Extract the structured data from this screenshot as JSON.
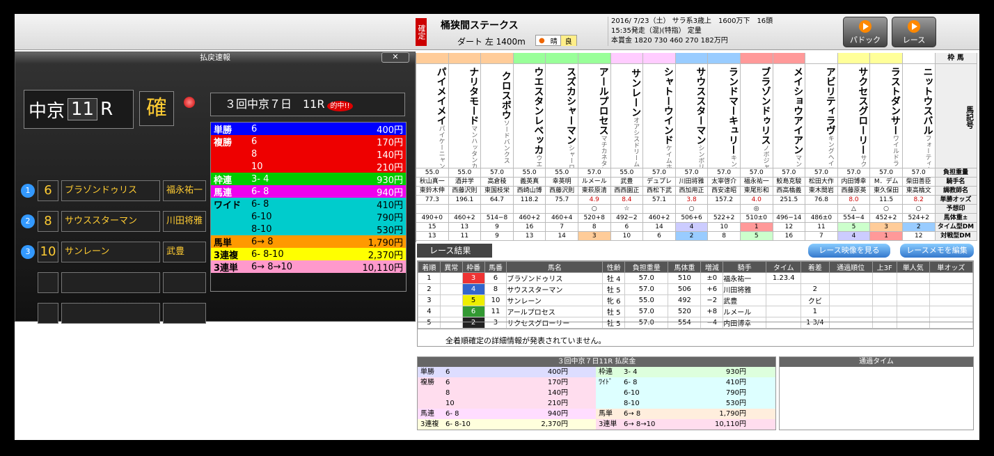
{
  "header": {
    "kakutei": "確定",
    "race_name": "桶狭間ステークス",
    "course": "ダート 左 1400m",
    "weather": "晴",
    "baba": "良",
    "info1": "2016/ 7/23（土） サラ系3歳上　1600万下　16頭",
    "info2": "15:35発走（混)(特指） 定量",
    "info3": "本賞金 1820 730 460 270 182万円",
    "btn_paddock": "パドック",
    "btn_race": "レース"
  },
  "panel": {
    "title": "払戻速報",
    "close": "✕",
    "place": "中京",
    "race_no": "11",
    "r": "R",
    "kaku": "確",
    "race_label": "３回中京７日　11R",
    "hit": "的中!!",
    "results": [
      {
        "pos": "1",
        "num": "6",
        "horse": "ブラゾンドゥリス",
        "jockey": "福永祐一"
      },
      {
        "pos": "2",
        "num": "8",
        "horse": "サウススターマン",
        "jockey": "川田将雅"
      },
      {
        "pos": "3",
        "num": "10",
        "horse": "サンレーン",
        "jockey": "武豊"
      }
    ],
    "pay": [
      {
        "type": "単勝",
        "combo": "6",
        "pay": "400円",
        "bg": "#00f"
      },
      {
        "type": "複勝",
        "combo": "6",
        "pay": "170円",
        "bg": "#e00"
      },
      {
        "type": "",
        "combo": "8",
        "pay": "140円",
        "bg": "#e00"
      },
      {
        "type": "",
        "combo": "10",
        "pay": "210円",
        "bg": "#e00"
      },
      {
        "type": "枠連",
        "combo": "3- 4",
        "pay": "930円",
        "bg": "#0c0"
      },
      {
        "type": "馬連",
        "combo": "6- 8",
        "pay": "940円",
        "bg": "#e0e"
      },
      {
        "type": "ワイド",
        "combo": "6- 8",
        "pay": "410円",
        "bg": "#0cc"
      },
      {
        "type": "",
        "combo": "6-10",
        "pay": "790円",
        "bg": "#0cc"
      },
      {
        "type": "",
        "combo": "8-10",
        "pay": "530円",
        "bg": "#0cc"
      },
      {
        "type": "馬単",
        "combo": "6→ 8",
        "pay": "1,790円",
        "bg": "#f90"
      },
      {
        "type": "3連複",
        "combo": "6- 8-10",
        "pay": "2,370円",
        "bg": "#ff0"
      },
      {
        "type": "3連単",
        "combo": "6→ 8→10",
        "pay": "10,110円",
        "bg": "#f9c"
      }
    ]
  },
  "entries": {
    "waku_row": [
      "16",
      "⑧",
      "15",
      "14",
      "⑦",
      "13",
      "12",
      "⑥",
      "11",
      "10",
      "⑤",
      "9",
      "8",
      "④",
      "7",
      "6",
      "③",
      "5",
      "4",
      "②",
      "3",
      "2",
      "①",
      "1"
    ],
    "horses": [
      {
        "n": "パイメイメイ",
        "w": "#fc9",
        "f": "パイケーニャン",
        "wt": "55.0",
        "j": "秋山真一",
        "t": "東鈴木伸",
        "o": "77.3",
        "m": "",
        "bw": "490+0",
        "t1": "15",
        "t2": "13"
      },
      {
        "n": "ナリタモード",
        "w": "#fc9",
        "f": "マンハッタンカフェ",
        "wt": "55.0",
        "j": "酒井学",
        "t": "西藤沢則",
        "o": "196.1",
        "m": "",
        "bw": "460+2",
        "t1": "13",
        "t2": "11"
      },
      {
        "n": "クロスボウ",
        "w": "#fc9",
        "f": "ソードバンクス",
        "wt": "57.0",
        "j": "高倉稜",
        "t": "東国枝栄",
        "o": "64.7",
        "m": "",
        "bw": "514−8",
        "t1": "9",
        "t2": "9"
      },
      {
        "n": "ウエスタンレベッカ",
        "w": "#9f9",
        "f": "ウエスタンアロー",
        "wt": "55.0",
        "j": "義英真",
        "t": "西崎山博",
        "o": "118.2",
        "m": "",
        "bw": "460+2",
        "t1": "16",
        "t2": "13"
      },
      {
        "n": "スズカシャーマン",
        "w": "#9f9",
        "f": "シャーロック",
        "wt": "55.0",
        "j": "幸英明",
        "t": "西藤沢則",
        "o": "75.7",
        "m": "",
        "bw": "460+4",
        "t1": "7",
        "t2": "14"
      },
      {
        "n": "アールプロセス",
        "w": "#9f9",
        "f": "マチカネタンホイザ",
        "wt": "57.0",
        "j": "ルメール",
        "t": "東萩原清",
        "o": "4.9",
        "m": "○",
        "bw": "520+8",
        "t1": "8",
        "t2": "3"
      },
      {
        "n": "サンレーン",
        "w": "#fcf",
        "f": "オアシスドリーム",
        "wt": "55.0",
        "j": "武豊",
        "t": "西西園正",
        "o": "8.4",
        "m": "☆",
        "bw": "492−2",
        "t1": "6",
        "t2": "10"
      },
      {
        "n": "シャトーウインド",
        "w": "#fcf",
        "f": "ケイムホーム",
        "wt": "57.0",
        "j": "デュプレ",
        "t": "西松下武",
        "o": "57.1",
        "m": "",
        "bw": "460+2",
        "t1": "14",
        "t2": "6"
      },
      {
        "n": "サウススターマン",
        "w": "#9cf",
        "f": "シンボリクリスエス",
        "wt": "57.0",
        "j": "川田将雅",
        "t": "西加用正",
        "o": "3.8",
        "m": "○",
        "bw": "506+6",
        "t1": "4",
        "t2": "2"
      },
      {
        "n": "ランドマーキュリー",
        "w": "#9cf",
        "f": "キングカメハメハ",
        "wt": "57.0",
        "j": "太宰啓介",
        "t": "西安達昭",
        "o": "157.2",
        "m": "",
        "bw": "522+2",
        "t1": "10",
        "t2": "8"
      },
      {
        "n": "ブラゾンドゥリス",
        "w": "#f99",
        "f": "ノボジャック",
        "wt": "57.0",
        "j": "福永祐一",
        "t": "東尾形和",
        "o": "4.0",
        "m": "◎",
        "bw": "510±0",
        "t1": "1",
        "t2": "5"
      },
      {
        "n": "メイショウアイアン",
        "w": "#f99",
        "f": "マンハッタンカフェ",
        "wt": "57.0",
        "j": "鮫島克駿",
        "t": "西高橋義",
        "o": "251.5",
        "m": "",
        "bw": "496−14",
        "t1": "12",
        "t2": "16"
      },
      {
        "n": "アビリティラヴ",
        "w": "#fff",
        "f": "キングヘイロー",
        "wt": "57.0",
        "j": "松田大作",
        "t": "東木間岩",
        "o": "76.8",
        "m": "",
        "bw": "486±0",
        "t1": "11",
        "t2": "7"
      },
      {
        "n": "サクセスグローリー",
        "w": "#ff9",
        "f": "サクセスブロッケン",
        "wt": "57.0",
        "j": "内田博幸",
        "t": "西藤原英",
        "o": "8.0",
        "m": "△",
        "bw": "554−4",
        "t1": "5",
        "t2": "4"
      },
      {
        "n": "ラストダンサー",
        "w": "#ff9",
        "f": "ワイルドラッシュ",
        "wt": "57.0",
        "j": "M．デム",
        "t": "東久保田",
        "o": "11.5",
        "m": "○",
        "bw": "452+2",
        "t1": "3",
        "t2": "1"
      },
      {
        "n": "ニットウスバル",
        "w": "#fff",
        "f": "フォーティナイナー",
        "wt": "57.0",
        "j": "柴田善臣",
        "t": "東高橋文",
        "o": "8.2",
        "m": "○",
        "bw": "524+2",
        "t1": "2",
        "t2": "12"
      }
    ],
    "labels": [
      "枠 馬",
      "馬記号",
      "負担重量",
      "騎手名",
      "調教師名",
      "単勝オッズ",
      "予想印",
      "馬体重±",
      "タイム型DM",
      "対戦型DM"
    ]
  },
  "result": {
    "title": "レース結果",
    "btn_video": "レース映像を見る",
    "btn_memo": "レースメモを編集",
    "headers": [
      "着順",
      "異常",
      "枠番",
      "馬番",
      "馬名",
      "性齢",
      "負担重量",
      "馬体重",
      "増減",
      "騎手",
      "タイム",
      "着差",
      "通過順位",
      "上3F",
      "単人気",
      "単オッズ"
    ],
    "rows": [
      {
        "pos": "1",
        "waku": "3",
        "wc": "#e33",
        "num": "6",
        "name": "ブラゾンドゥリス",
        "sex": "牡 4",
        "wt": "57.0",
        "bw": "510",
        "inc": "±0",
        "jk": "福永祐一",
        "time": "1.23.4",
        "diff": ""
      },
      {
        "pos": "2",
        "waku": "4",
        "wc": "#36c",
        "num": "8",
        "name": "サウススターマン",
        "sex": "牡 5",
        "wt": "57.0",
        "bw": "506",
        "inc": "+6",
        "jk": "川田将雅",
        "time": "",
        "diff": "2"
      },
      {
        "pos": "3",
        "waku": "5",
        "wc": "#ee0",
        "num": "10",
        "name": "サンレーン",
        "sex": "牝 6",
        "wt": "55.0",
        "bw": "492",
        "inc": "−2",
        "jk": "武豊",
        "time": "",
        "diff": "クビ"
      },
      {
        "pos": "4",
        "waku": "6",
        "wc": "#393",
        "num": "11",
        "name": "アールプロセス",
        "sex": "牡 5",
        "wt": "57.0",
        "bw": "520",
        "inc": "+8",
        "jk": "ルメール",
        "time": "",
        "diff": "1"
      },
      {
        "pos": "5",
        "waku": "2",
        "wc": "#222",
        "num": "3",
        "name": "サクセスグローリー",
        "sex": "牡 5",
        "wt": "57.0",
        "bw": "554",
        "inc": "−4",
        "jk": "内田博幸",
        "time": "",
        "diff": "1 3/4"
      }
    ],
    "note": "全着順確定の詳細情報が発表されていません。"
  },
  "bottom": {
    "title": "３回中京７日11R 払戻金",
    "tt_title": "通過タイム",
    "left": [
      {
        "t": "単勝",
        "c": "6",
        "p": "400円",
        "bg": "#ddf"
      },
      {
        "t": "複勝",
        "c": "6",
        "p": "170円",
        "bg": "#fde"
      },
      {
        "t": "",
        "c": "8",
        "p": "140円",
        "bg": "#fde"
      },
      {
        "t": "",
        "c": "10",
        "p": "210円",
        "bg": "#fde"
      },
      {
        "t": "馬連",
        "c": "6- 8",
        "p": "940円",
        "bg": "#fdf"
      },
      {
        "t": "3連複",
        "c": "6- 8-10",
        "p": "2,370円",
        "bg": "#ffd"
      }
    ],
    "right": [
      {
        "t": "枠連",
        "c": "3- 4",
        "p": "930円",
        "bg": "#dfd"
      },
      {
        "t": "ﾜｲﾄﾞ",
        "c": "6- 8",
        "p": "410円",
        "bg": "#dff"
      },
      {
        "t": "",
        "c": "6-10",
        "p": "790円",
        "bg": "#dff"
      },
      {
        "t": "",
        "c": "8-10",
        "p": "530円",
        "bg": "#dff"
      },
      {
        "t": "馬単",
        "c": "6→ 8",
        "p": "1,790円",
        "bg": "#fed"
      },
      {
        "t": "3連単",
        "c": "6→ 8→10",
        "p": "10,110円",
        "bg": "#fde"
      }
    ]
  }
}
